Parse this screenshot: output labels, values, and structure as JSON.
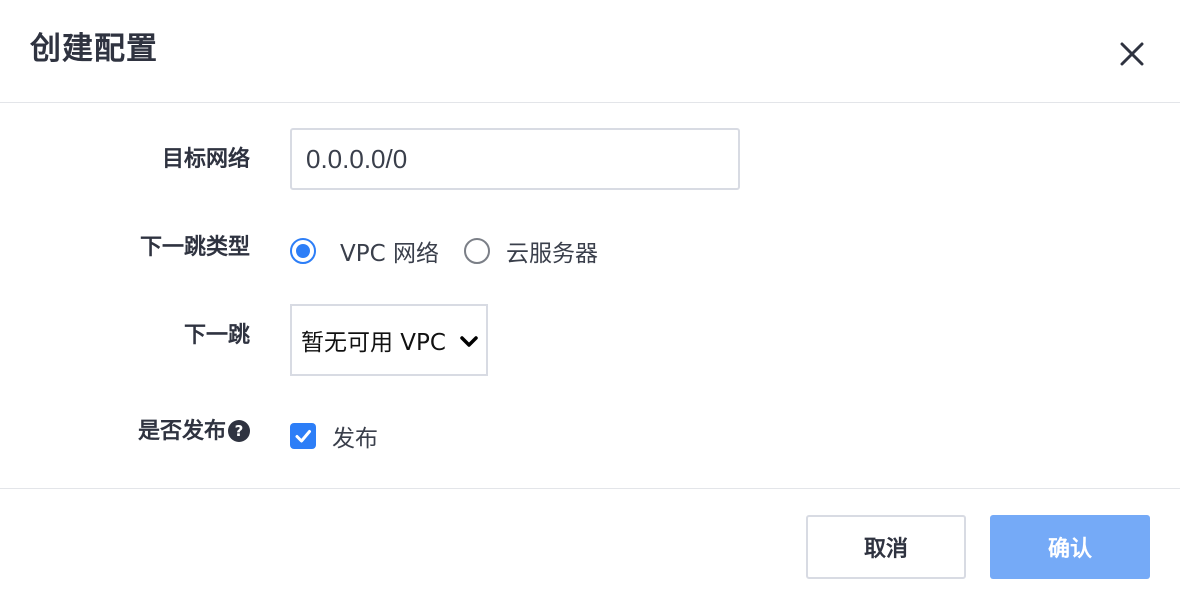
{
  "dialog": {
    "title": "创建配置"
  },
  "form": {
    "target_network": {
      "label": "目标网络",
      "value": "0.0.0.0/0"
    },
    "next_hop_type": {
      "label": "下一跳类型",
      "options": [
        {
          "label": "VPC 网络",
          "checked": true
        },
        {
          "label": "云服务器",
          "checked": false
        }
      ]
    },
    "next_hop": {
      "label": "下一跳",
      "selected": "暂无可用 VPC"
    },
    "publish": {
      "label": "是否发布",
      "help_icon": "?",
      "checkbox_label": "发布",
      "checked": true
    }
  },
  "footer": {
    "cancel_label": "取消",
    "confirm_label": "确认"
  },
  "colors": {
    "accent": "#2d7ef7",
    "confirm_disabled": "#75aaf7",
    "border": "#d8dbe3",
    "divider": "#e3e5e9",
    "text": "#2f3340"
  },
  "icons": {
    "close": "close-icon",
    "chevron": "chevron-down-icon",
    "check": "check-icon",
    "help": "question-circle-icon"
  }
}
